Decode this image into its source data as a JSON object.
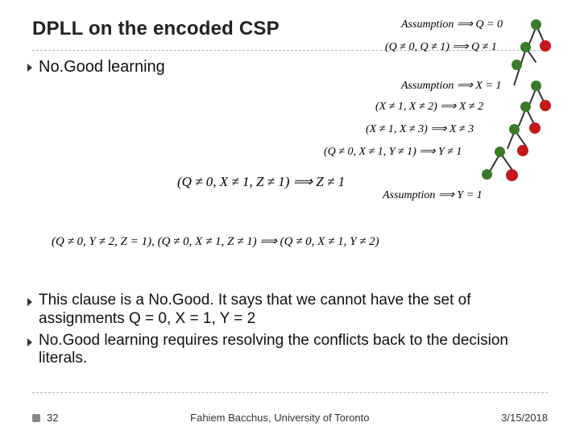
{
  "title": "DPLL on the encoded CSP",
  "bullets": {
    "top": "No.Good learning",
    "body1": "This clause is a No.Good. It says that we cannot have the set of assignments Q = 0, X = 1, Y = 2",
    "body2": "No.Good learning requires resolving the conflicts back to the decision literals."
  },
  "formulas": {
    "f1": "Assumption ⟹ Q = 0",
    "f2": "(Q ≠ 0, Q ≠ 1) ⟹ Q ≠ 1",
    "f3": "Assumption ⟹ X = 1",
    "f4": "(X ≠ 1, X ≠ 2) ⟹ X ≠ 2",
    "f5": "(X ≠ 1, X ≠ 3) ⟹ X ≠ 3",
    "f6": "(Q ≠ 0, X ≠ 1, Y ≠ 1) ⟹ Y ≠ 1",
    "f7": "(Q ≠ 0, X ≠ 1, Z ≠ 1) ⟹ Z ≠ 1",
    "long": "(Q ≠ 0, Y ≠ 2, Z = 1), (Q ≠ 0, X ≠ 1, Z ≠ 1) ⟹ (Q ≠ 0, X ≠ 1, Y ≠ 2)"
  },
  "footer": {
    "page": "32",
    "center": "Fahiem Bacchus, University of Toronto",
    "date": "3/15/2018"
  }
}
